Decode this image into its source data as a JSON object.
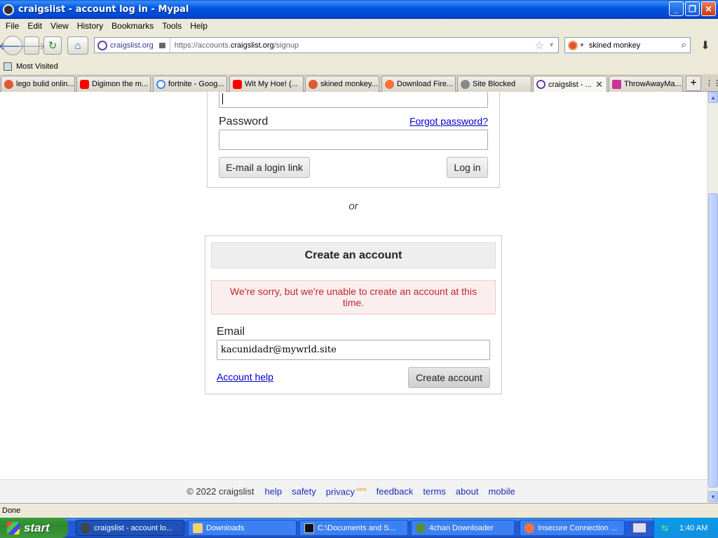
{
  "window": {
    "title": "craigslist - account log in - Mypal",
    "buttons": [
      "_",
      "❐",
      "✕"
    ]
  },
  "menubar": [
    "File",
    "Edit",
    "View",
    "History",
    "Bookmarks",
    "Tools",
    "Help"
  ],
  "nav": {
    "identity": "craigslist.org",
    "url_prefix": "https://accounts.",
    "url_domain": "craigslist.org",
    "url_path": "/signup",
    "search_value": "skined monkey"
  },
  "bookmarks": {
    "label": "Most Visited"
  },
  "tabs": [
    {
      "label": "lego bulid onlin...",
      "color": "#de5833"
    },
    {
      "label": "Digimon the m...",
      "color": "#ff0000"
    },
    {
      "label": "fortnite - Goog...",
      "color": "#4285f4"
    },
    {
      "label": "Wit My Hoe! (...",
      "color": "#ff0000"
    },
    {
      "label": "skined monkey...",
      "color": "#de5833"
    },
    {
      "label": "Download Fire...",
      "color": "#ff7139"
    },
    {
      "label": "Site Blocked",
      "color": "#888888"
    },
    {
      "label": "craigslist - ...",
      "color": "#6a3fa0"
    },
    {
      "label": "ThrowAwayMa...",
      "color": "#cc3399"
    }
  ],
  "login": {
    "password_label": "Password",
    "forgot_link": "Forgot password?",
    "email_link_button": "E-mail a login link",
    "login_button": "Log in"
  },
  "or_text": "or",
  "create": {
    "heading": "Create an account",
    "error": "We're sorry, but we're unable to create an account at this time.",
    "email_label": "Email",
    "email_value": "kacunidadr@mywrld.site",
    "help_link": "Account help",
    "create_button": "Create account"
  },
  "footer": {
    "copyright": "© 2022 craigslist",
    "links": [
      "help",
      "safety",
      "privacy",
      "feedback",
      "terms",
      "about",
      "mobile"
    ],
    "new_badge": "new"
  },
  "statusbar": {
    "text": "Done"
  },
  "taskbar": {
    "start": "start",
    "tasks": [
      {
        "label": "craigslist - account lo...",
        "active": true
      },
      {
        "label": "Downloads",
        "active": false
      },
      {
        "label": "C:\\Documents and S...",
        "active": false
      },
      {
        "label": "4chan Downloader",
        "active": false
      },
      {
        "label": "Insecure Connection ...",
        "active": false
      }
    ],
    "clock": "1:40 AM"
  }
}
